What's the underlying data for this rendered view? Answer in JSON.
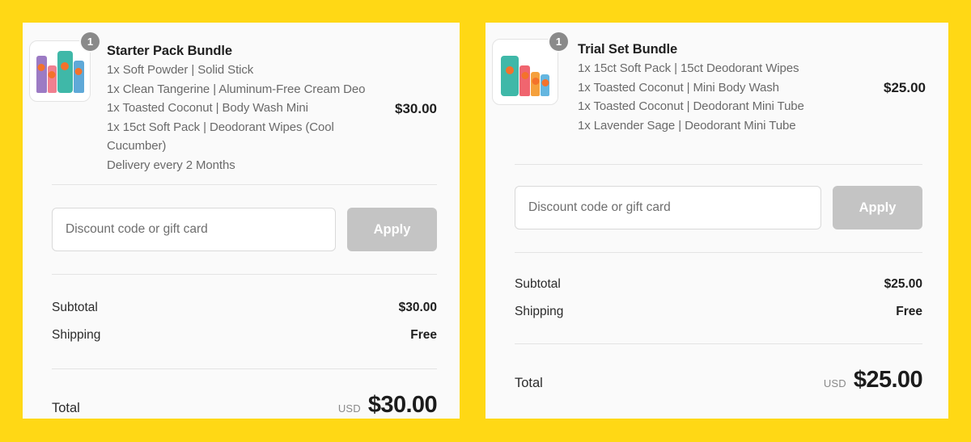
{
  "theme": {
    "page_background": "#FFD815",
    "panel_background": "#FAFAFA",
    "apply_button_color": "#C4C4C4",
    "divider_color": "#E4E4E4",
    "badge_color": "#8A8A8A",
    "muted_text_color": "#6A6A6A"
  },
  "left_summary": {
    "product": {
      "title": "Starter Pack Bundle",
      "quantity_badge": "1",
      "price": "$30.00",
      "lines": [
        "1x Soft Powder | Solid Stick",
        "1x Clean Tangerine | Aluminum-Free Cream Deo",
        "1x Toasted Coconut | Body Wash Mini",
        "1x 15ct Soft Pack | Deodorant Wipes (Cool Cucumber)",
        "Delivery every 2 Months"
      ]
    },
    "discount": {
      "placeholder": "Discount code or gift card",
      "value": "",
      "apply_label": "Apply"
    },
    "totals": [
      {
        "label": "Subtotal",
        "value": "$30.00"
      },
      {
        "label": "Shipping",
        "value": "Free"
      }
    ],
    "grand_total": {
      "label": "Total",
      "currency": "USD",
      "amount": "$30.00"
    }
  },
  "right_summary": {
    "product": {
      "title": "Trial Set Bundle",
      "quantity_badge": "1",
      "price": "$25.00",
      "lines": [
        "1x 15ct Soft Pack | 15ct Deodorant Wipes",
        "1x Toasted Coconut | Mini Body Wash",
        "1x Toasted Coconut | Deodorant Mini Tube",
        "1x Lavender Sage | Deodorant Mini Tube"
      ]
    },
    "discount": {
      "placeholder": "Discount code or gift card",
      "value": "",
      "apply_label": "Apply"
    },
    "totals": [
      {
        "label": "Subtotal",
        "value": "$25.00"
      },
      {
        "label": "Shipping",
        "value": "Free"
      }
    ],
    "grand_total": {
      "label": "Total",
      "currency": "USD",
      "amount": "$25.00"
    }
  }
}
